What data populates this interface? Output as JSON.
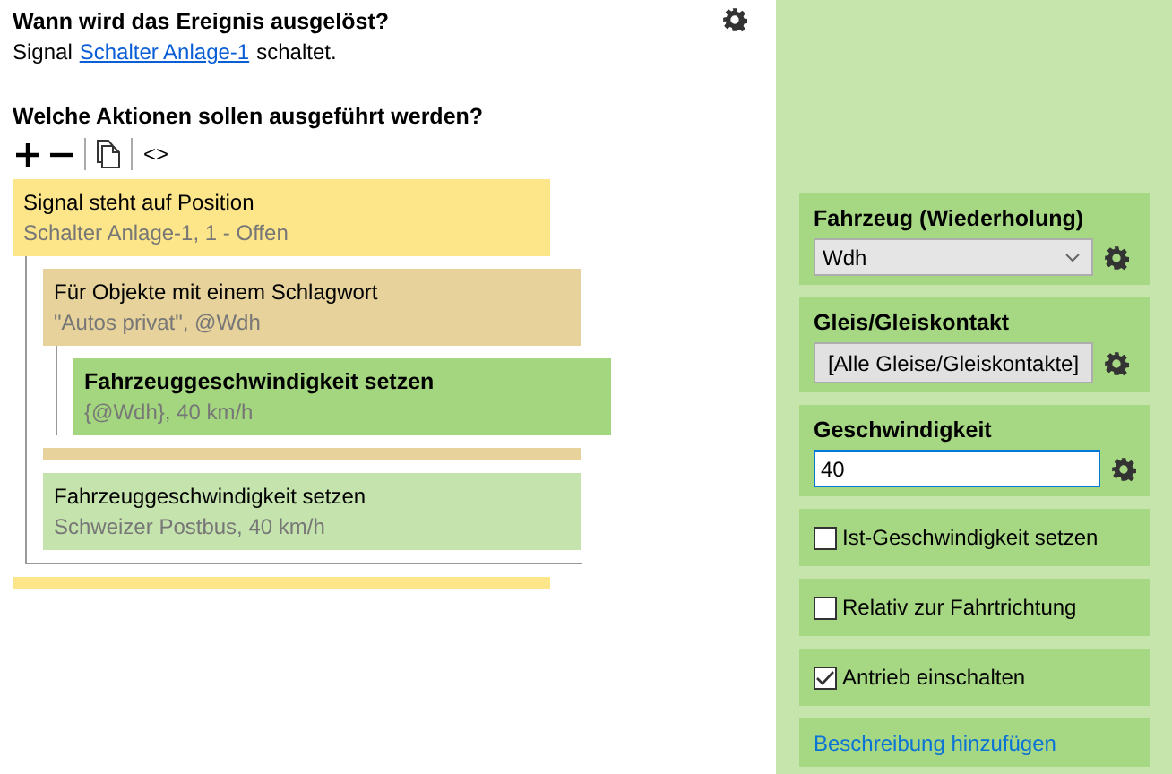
{
  "trigger": {
    "title": "Wann wird das Ereignis ausgelöst?",
    "prefix": "Signal",
    "link": "Schalter Anlage-1",
    "suffix": "schaltet."
  },
  "actions_title": "Welche Aktionen sollen ausgeführt werden?",
  "toolbar": [
    {
      "kind": "add"
    },
    {
      "kind": "remove"
    },
    {
      "kind": "separator"
    },
    {
      "kind": "copy"
    },
    {
      "kind": "separator"
    },
    {
      "kind": "code",
      "label": "<>"
    }
  ],
  "actions": [
    {
      "kind": "condition",
      "title": "Signal steht auf Position",
      "detail": "Schalter Anlage-1, 1 - Offen",
      "selected": false,
      "children": [
        {
          "kind": "loop",
          "title": "Für Objekte mit einem Schlagwort",
          "detail": "\"Autos privat\", @Wdh",
          "selected": false,
          "children": [
            {
              "kind": "action",
              "title": "Fahrzeuggeschwindigkeit setzen",
              "detail": "{@Wdh}, 40 km/h",
              "selected": true
            }
          ]
        },
        {
          "kind": "action",
          "title": "Fahrzeuggeschwindigkeit setzen",
          "detail": "Schweizer Postbus, 40 km/h",
          "selected": false
        }
      ]
    }
  ],
  "properties": [
    {
      "kind": "select",
      "label": "Fahrzeug (Wiederholung)",
      "value": "Wdh"
    },
    {
      "kind": "button",
      "label": "Gleis/Gleiskontakt",
      "value": "[Alle Gleise/Gleiskontakte]"
    },
    {
      "kind": "input",
      "label": "Geschwindigkeit",
      "value": "40"
    },
    {
      "kind": "checkbox",
      "label": "Ist-Geschwindigkeit setzen",
      "checked": false
    },
    {
      "kind": "checkbox",
      "label": "Relativ zur Fahrtrichtung",
      "checked": false
    },
    {
      "kind": "checkbox",
      "label": "Antrieb einschalten",
      "checked": true
    },
    {
      "kind": "link",
      "label": "Beschreibung hinzufügen"
    }
  ]
}
